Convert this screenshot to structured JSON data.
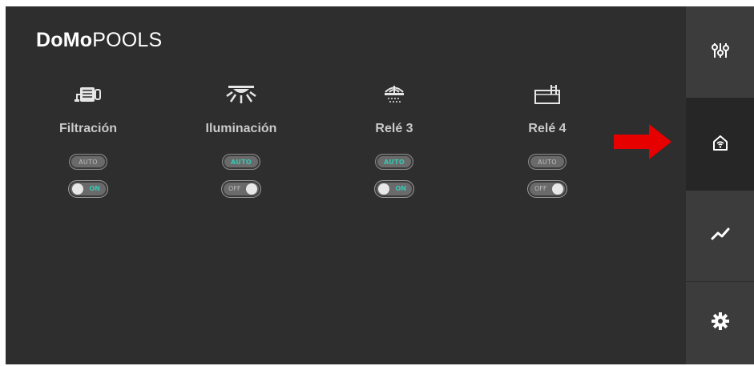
{
  "brand": {
    "part1": "DoMo",
    "part2": "POOLS"
  },
  "devices": [
    {
      "label": "Filtración",
      "icon": "pump-icon",
      "auto_label": "AUTO",
      "auto_active": false,
      "switch_label": "ON",
      "switch_on": true
    },
    {
      "label": "Iluminación",
      "icon": "light-icon",
      "auto_label": "AUTO",
      "auto_active": true,
      "switch_label": "OFF",
      "switch_on": false
    },
    {
      "label": "Relé 3",
      "icon": "fountain-icon",
      "auto_label": "AUTO",
      "auto_active": true,
      "switch_label": "ON",
      "switch_on": true
    },
    {
      "label": "Relé 4",
      "icon": "pool-icon",
      "auto_label": "AUTO",
      "auto_active": false,
      "switch_label": "OFF",
      "switch_on": false
    }
  ],
  "sidebar": {
    "items": [
      {
        "name": "controls",
        "icon": "sliders-icon",
        "active": false
      },
      {
        "name": "home",
        "icon": "home-wifi-icon",
        "active": true
      },
      {
        "name": "stats",
        "icon": "trend-icon",
        "active": false
      },
      {
        "name": "settings",
        "icon": "gear-icon",
        "active": false
      }
    ]
  },
  "colors": {
    "background": "#2e2e2e",
    "sidebar": "#3c3c3c",
    "sidebar_active": "#262626",
    "accent": "#38c7b3",
    "arrow": "#e60000"
  }
}
